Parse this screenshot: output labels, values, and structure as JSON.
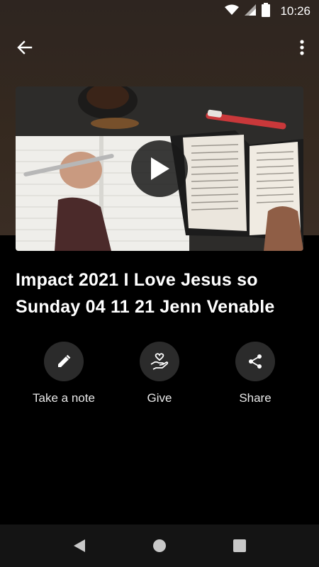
{
  "status_bar": {
    "time": "10:26"
  },
  "media": {
    "title": "Impact 2021 I Love Jesus so Sunday 04 11 21 Jenn Venable"
  },
  "actions": [
    {
      "label": "Take a note",
      "icon": "pencil-icon"
    },
    {
      "label": "Give",
      "icon": "give-heart-hand-icon"
    },
    {
      "label": "Share",
      "icon": "share-icon"
    }
  ],
  "nav": {
    "icons": [
      "back-triangle-icon",
      "home-circle-icon",
      "recents-square-icon"
    ]
  }
}
